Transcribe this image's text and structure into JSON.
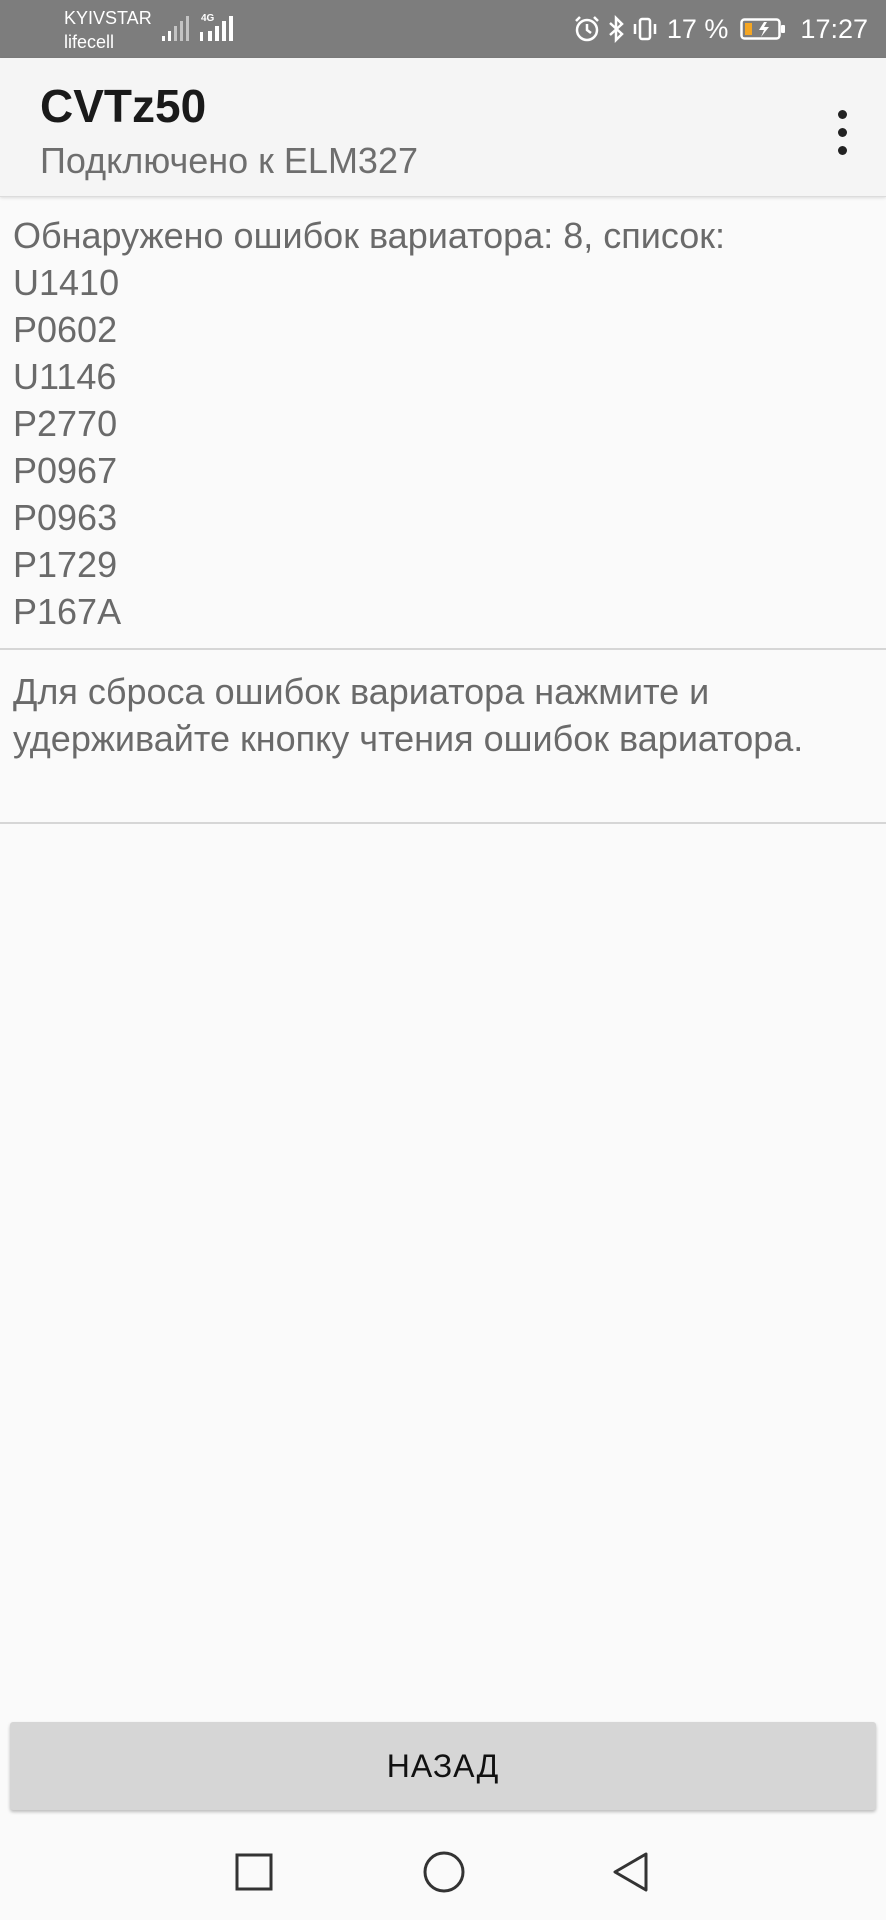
{
  "status_bar": {
    "carrier_1": "KYIVSTAR",
    "carrier_2": "lifecell",
    "network_type": "4G",
    "battery_percent": "17 %",
    "time": "17:27",
    "icons": [
      "signal-icon",
      "signal-4g-icon",
      "alarm-icon",
      "bluetooth-icon",
      "vibrate-icon",
      "battery-charging-icon"
    ]
  },
  "app_bar": {
    "title": "CVTz50",
    "subtitle": "Подключено к ELM327",
    "menu_icon": "more-vertical-icon"
  },
  "errors": {
    "header": "Обнаружено ошибок вариатора: 8, список:",
    "codes": [
      "U1410",
      "P0602",
      "U1146",
      "P2770",
      "P0967",
      "P0963",
      "P1729",
      "P167A"
    ]
  },
  "reset_hint": "Для сброса ошибок вариатора нажмите и удерживайте кнопку чтения ошибок вариатора.",
  "back_button_label": "НАЗАД",
  "nav_bar": {
    "icons": [
      "recent-apps-icon",
      "home-icon",
      "back-icon"
    ]
  }
}
